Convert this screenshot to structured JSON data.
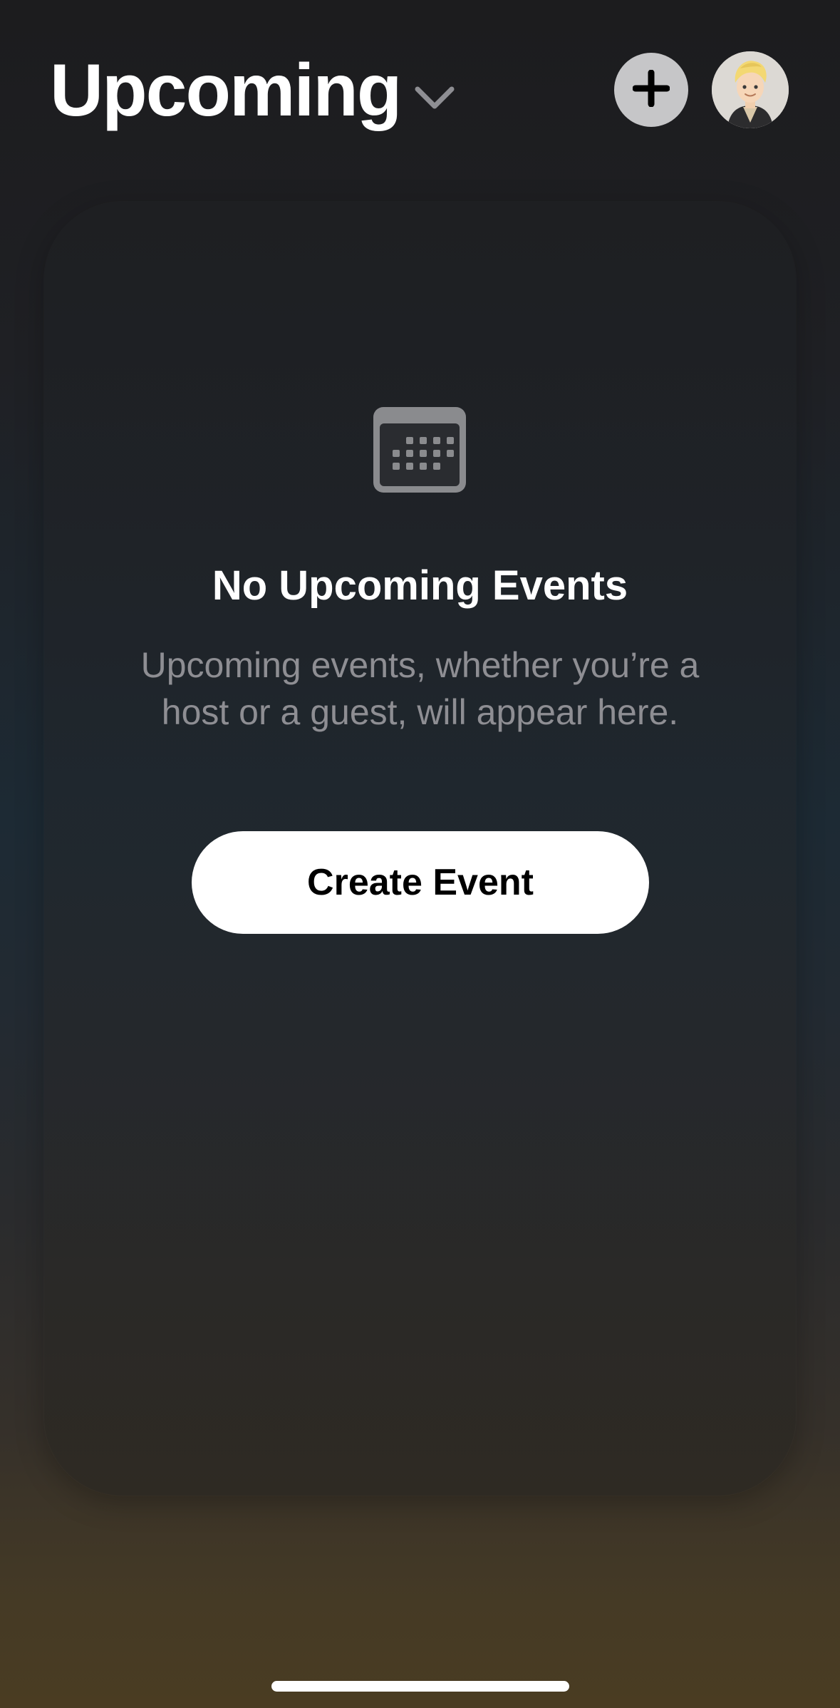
{
  "header": {
    "title": "Upcoming",
    "title_menu_icon": "chevron-down-icon",
    "add_icon": "plus-icon",
    "avatar_icon": "memoji-avatar"
  },
  "empty_state": {
    "icon": "calendar-icon",
    "title": "No Upcoming Events",
    "subtitle": "Upcoming events, whether you’re a host or a guest, will appear here.",
    "button_label": "Create Event"
  },
  "colors": {
    "title_text": "#ffffff",
    "subtitle_text": "#8e8e93",
    "add_button_bg": "#c6c6c8",
    "create_button_bg": "#ffffff",
    "icon_gray": "#8a8b8e"
  }
}
